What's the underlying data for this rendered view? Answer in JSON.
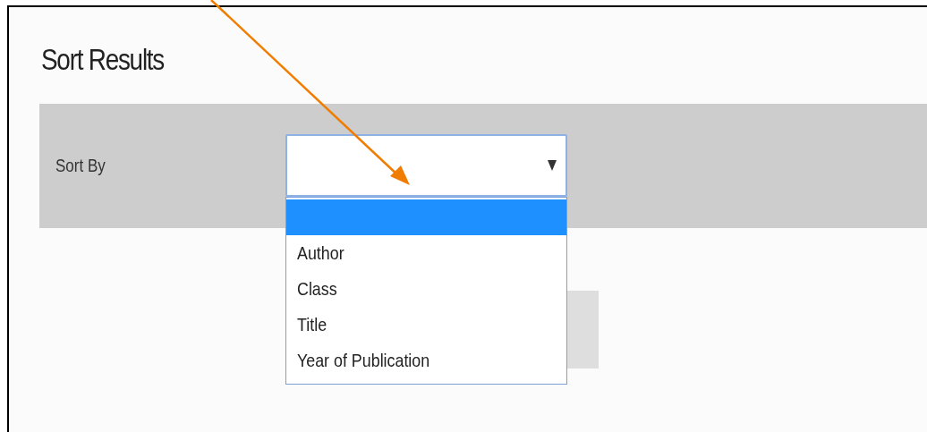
{
  "title": "Sort Results",
  "sort_by": {
    "label": "Sort By",
    "expanded": true,
    "options": [
      {
        "selected": true
      },
      {
        "label": "Author",
        "selected": false
      },
      {
        "label": "Class",
        "selected": false
      },
      {
        "label": "Title",
        "selected": false
      },
      {
        "label": "Year of Publication",
        "selected": false
      }
    ]
  }
}
